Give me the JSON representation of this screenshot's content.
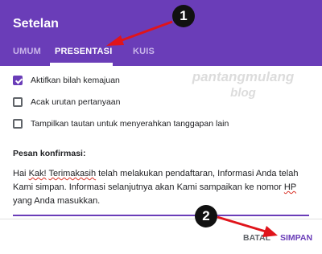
{
  "dialog": {
    "title": "Setelan"
  },
  "tabs": [
    {
      "label": "UMUM",
      "active": false
    },
    {
      "label": "PRESENTASI",
      "active": true
    },
    {
      "label": "KUIS",
      "active": false
    }
  ],
  "options": [
    {
      "label": "Aktifkan bilah kemajuan",
      "checked": true
    },
    {
      "label": "Acak urutan pertanyaan",
      "checked": false
    },
    {
      "label": "Tampilkan tautan untuk menyerahkan tanggapan lain",
      "checked": false
    }
  ],
  "confirmation": {
    "label": "Pesan konfirmasi:",
    "text_part1": "Hai ",
    "text_kak": "Kak!",
    "text_part2": " ",
    "text_terimakasih": "Terimakasih",
    "text_part3": " telah melakukan pendaftaran, Informasi Anda telah Kami simpan. Informasi selanjutnya akan Kami sampaikan ke nomor ",
    "text_hp": "HP",
    "text_part4": " yang Anda masukkan."
  },
  "footer": {
    "cancel_label": "BATAL",
    "save_label": "SIMPAN"
  },
  "watermark": {
    "line1": "pantangmulang",
    "line2": "blog"
  },
  "annotations": {
    "marker1": "1",
    "marker2": "2"
  },
  "colors": {
    "accent": "#6a3db8",
    "arrow": "#e0141b",
    "marker": "#111111"
  }
}
